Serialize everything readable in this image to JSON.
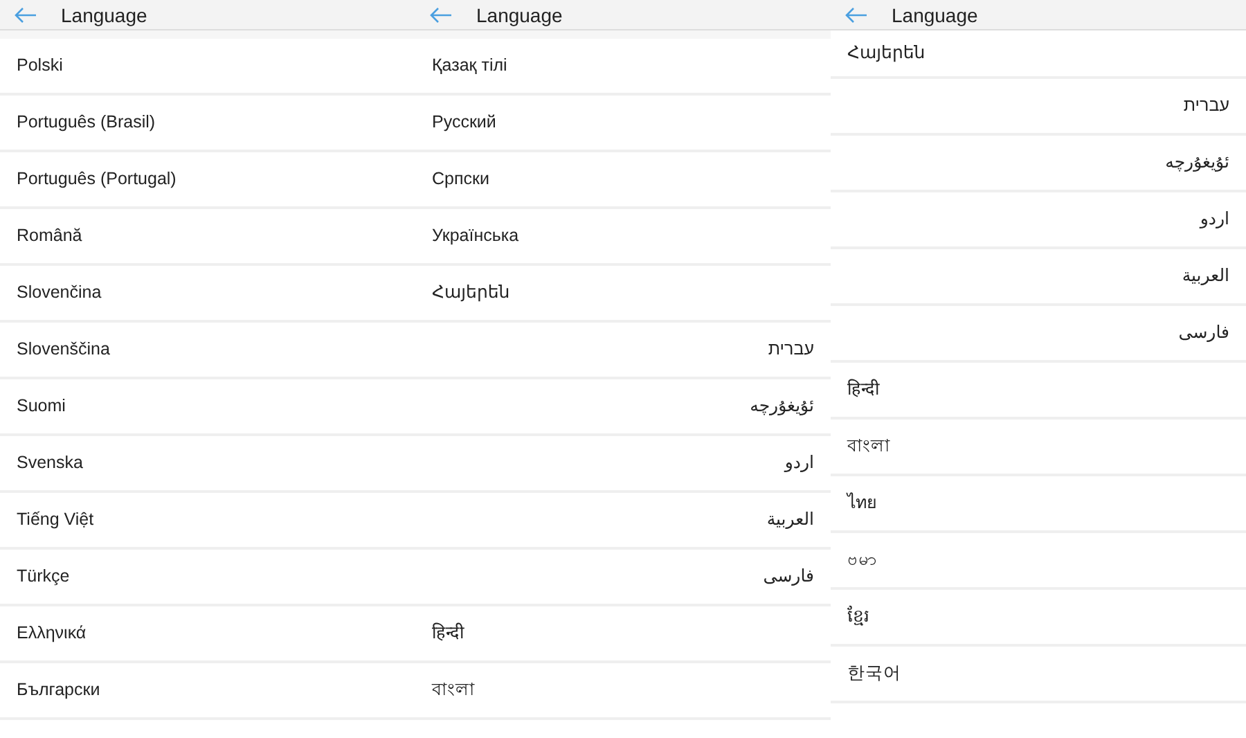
{
  "left_screen": {
    "title": "Language",
    "languages": [
      {
        "label": "Polski",
        "clipped": false
      },
      {
        "label": "Português (Brasil)",
        "clipped": false
      },
      {
        "label": "Português (Portugal)",
        "clipped": false
      },
      {
        "label": "Română",
        "clipped": false
      },
      {
        "label": "Slovenčina",
        "clipped": false
      },
      {
        "label": "Slovenščina",
        "clipped": false
      },
      {
        "label": "Suomi",
        "clipped": false
      },
      {
        "label": "Svenska",
        "clipped": false
      },
      {
        "label": "Tiếng Việt",
        "clipped": false
      },
      {
        "label": "Türkçe",
        "clipped": false
      },
      {
        "label": "Ελληνικά",
        "clipped": false
      },
      {
        "label": "Български",
        "clipped": false
      }
    ]
  },
  "middle_screen": {
    "title": "Language",
    "languages": [
      {
        "label": "Қазақ тілі",
        "clipped": false
      },
      {
        "label": "Русский",
        "clipped": false
      },
      {
        "label": "Српски",
        "clipped": false
      },
      {
        "label": "Українська",
        "clipped": false
      },
      {
        "label": "Հայերեն",
        "clipped": false
      },
      {
        "label": "עברית",
        "clipped": false
      },
      {
        "label": "ئۇيغۇرچە",
        "clipped": false
      },
      {
        "label": "اردو",
        "clipped": false
      },
      {
        "label": "العربية",
        "clipped": false
      },
      {
        "label": "فارسی",
        "clipped": false
      },
      {
        "label": "हिन्दी",
        "clipped": false
      },
      {
        "label": "বাংলা",
        "clipped": false
      }
    ]
  },
  "right_screen": {
    "title": "Language",
    "languages": [
      {
        "label": "Հայերեն",
        "clipped": true
      },
      {
        "label": "עברית",
        "clipped": false
      },
      {
        "label": "ئۇيغۇرچە",
        "clipped": false
      },
      {
        "label": "اردو",
        "clipped": false
      },
      {
        "label": "العربية",
        "clipped": false
      },
      {
        "label": "فارسی",
        "clipped": false
      },
      {
        "label": "हिन्दी",
        "clipped": false
      },
      {
        "label": "বাংলা",
        "clipped": false
      },
      {
        "label": "ไทย",
        "clipped": false
      },
      {
        "label": "ဗမာ",
        "clipped": false
      },
      {
        "label": "ខ្មែរ",
        "clipped": false
      },
      {
        "label": "한국어",
        "clipped": false
      }
    ]
  }
}
